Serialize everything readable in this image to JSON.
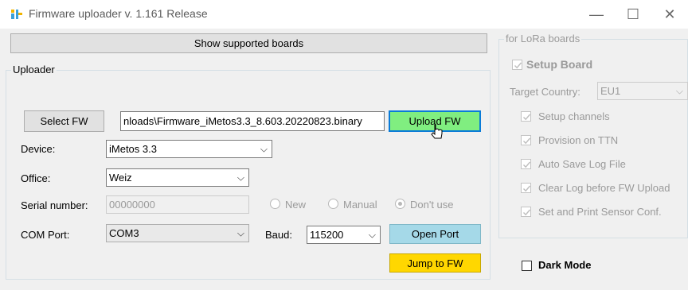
{
  "window": {
    "title": "Firmware uploader v. 1.161 Release",
    "controls": {
      "minimize": "—",
      "maximize": "☐",
      "close": "✕"
    }
  },
  "top": {
    "show_boards_label": "Show supported boards"
  },
  "uploader": {
    "legend": "Uploader",
    "select_fw_label": "Select FW",
    "fw_path": "nloads\\Firmware_iMetos3.3_8.603.20220823.binary",
    "upload_fw_label": "Upload FW",
    "device_label": "Device:",
    "device_value": "iMetos 3.3",
    "office_label": "Office:",
    "office_value": "Weiz",
    "serial_label": "Serial number:",
    "serial_value": "00000000",
    "radio_new": "New",
    "radio_manual": "Manual",
    "radio_dont_use": "Don't use",
    "com_label": "COM Port:",
    "com_value": "COM3",
    "baud_label": "Baud:",
    "baud_value": "115200",
    "open_port_label": "Open Port",
    "jump_fw_label": "Jump to FW"
  },
  "lora": {
    "legend": "for LoRa boards",
    "setup_board": "Setup Board",
    "target_country_label": "Target Country:",
    "target_country_value": "EU1",
    "options": [
      "Setup channels",
      "Provision on TTN",
      "Auto Save Log File",
      "Clear Log before FW Upload",
      "Set and Print Sensor Conf."
    ]
  },
  "dark_mode_label": "Dark Mode",
  "colors": {
    "upload_green": "#80ee80",
    "open_port_blue": "#a5d9e8",
    "jump_yellow": "#ffd700",
    "title_gray": "#5b5b5b"
  }
}
